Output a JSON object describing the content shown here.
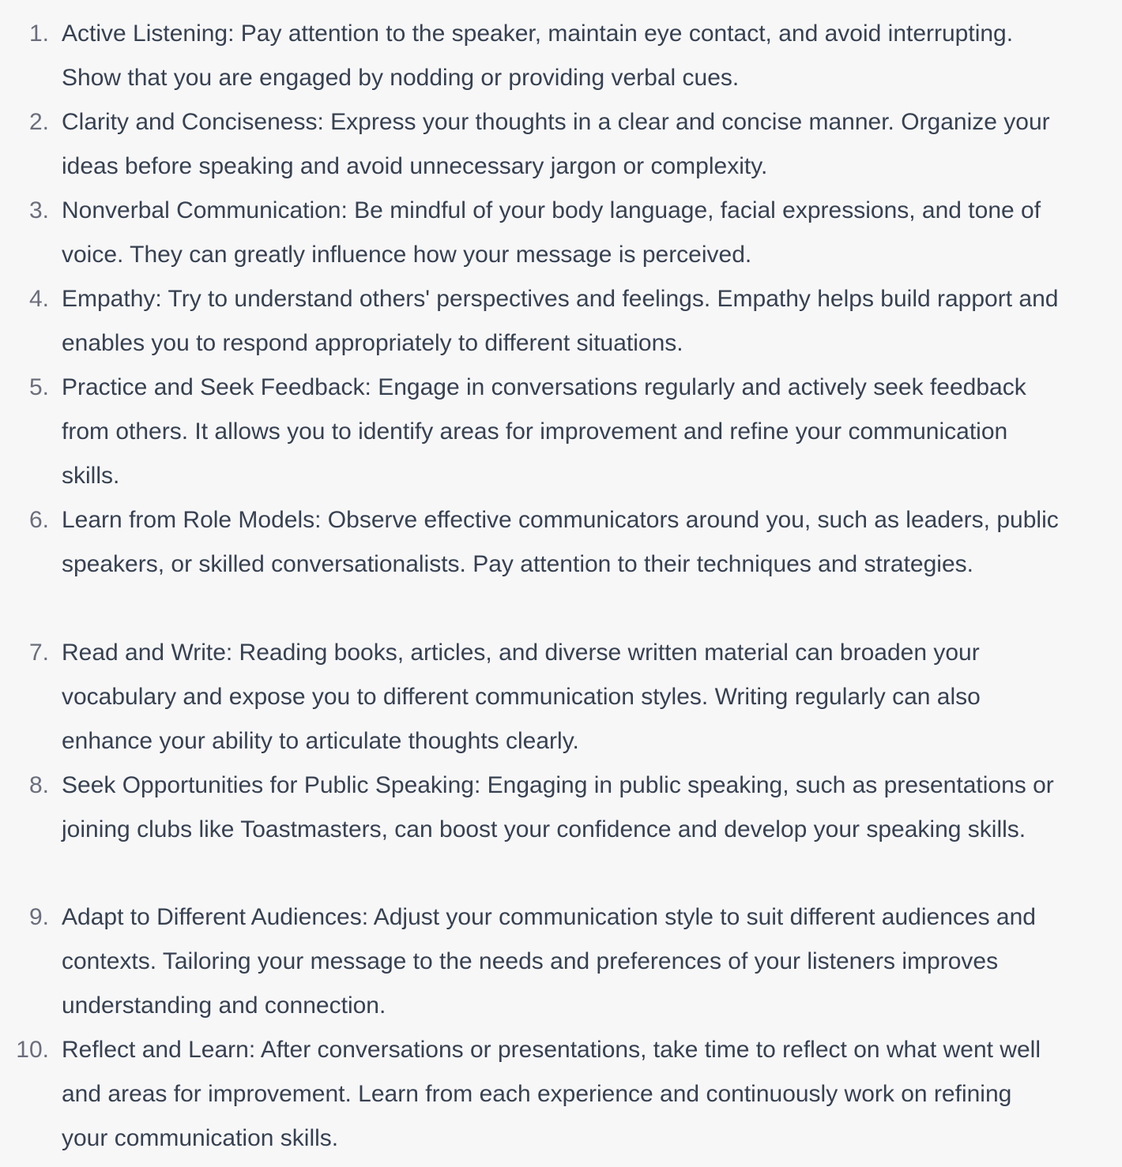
{
  "list": {
    "items": [
      {
        "number": "1.",
        "text": "Active Listening: Pay attention to the speaker, maintain eye contact, and avoid interrupting. Show that you are engaged by nodding or providing verbal cues."
      },
      {
        "number": "2.",
        "text": "Clarity and Conciseness: Express your thoughts in a clear and concise manner. Organize your ideas before speaking and avoid unnecessary jargon or complexity."
      },
      {
        "number": "3.",
        "text": "Nonverbal Communication: Be mindful of your body language, facial expressions, and tone of voice. They can greatly influence how your message is perceived."
      },
      {
        "number": "4.",
        "text": "Empathy: Try to understand others' perspectives and feelings. Empathy helps build rapport and enables you to respond appropriately to different situations."
      },
      {
        "number": "5.",
        "text": "Practice and Seek Feedback: Engage in conversations regularly and actively seek feedback from others. It allows you to identify areas for improvement and refine your communication skills."
      },
      {
        "number": "6.",
        "text": "Learn from Role Models: Observe effective communicators around you, such as leaders, public speakers, or skilled conversationalists. Pay attention to their techniques and strategies."
      },
      {
        "number": "7.",
        "text": "Read and Write: Reading books, articles, and diverse written material can broaden your vocabulary and expose you to different communication styles. Writing regularly can also enhance your ability to articulate thoughts clearly."
      },
      {
        "number": "8.",
        "text": "Seek Opportunities for Public Speaking: Engaging in public speaking, such as presentations or joining clubs like Toastmasters, can boost your confidence and develop your speaking skills."
      },
      {
        "number": "9.",
        "text": "Adapt to Different Audiences: Adjust your communication style to suit different audiences and contexts. Tailoring your message to the needs and preferences of your listeners improves understanding and connection."
      },
      {
        "number": "10.",
        "text": "Reflect and Learn: After conversations or presentations, take time to reflect on what went well and areas for improvement. Learn from each experience and continuously work on refining your communication skills."
      }
    ]
  }
}
